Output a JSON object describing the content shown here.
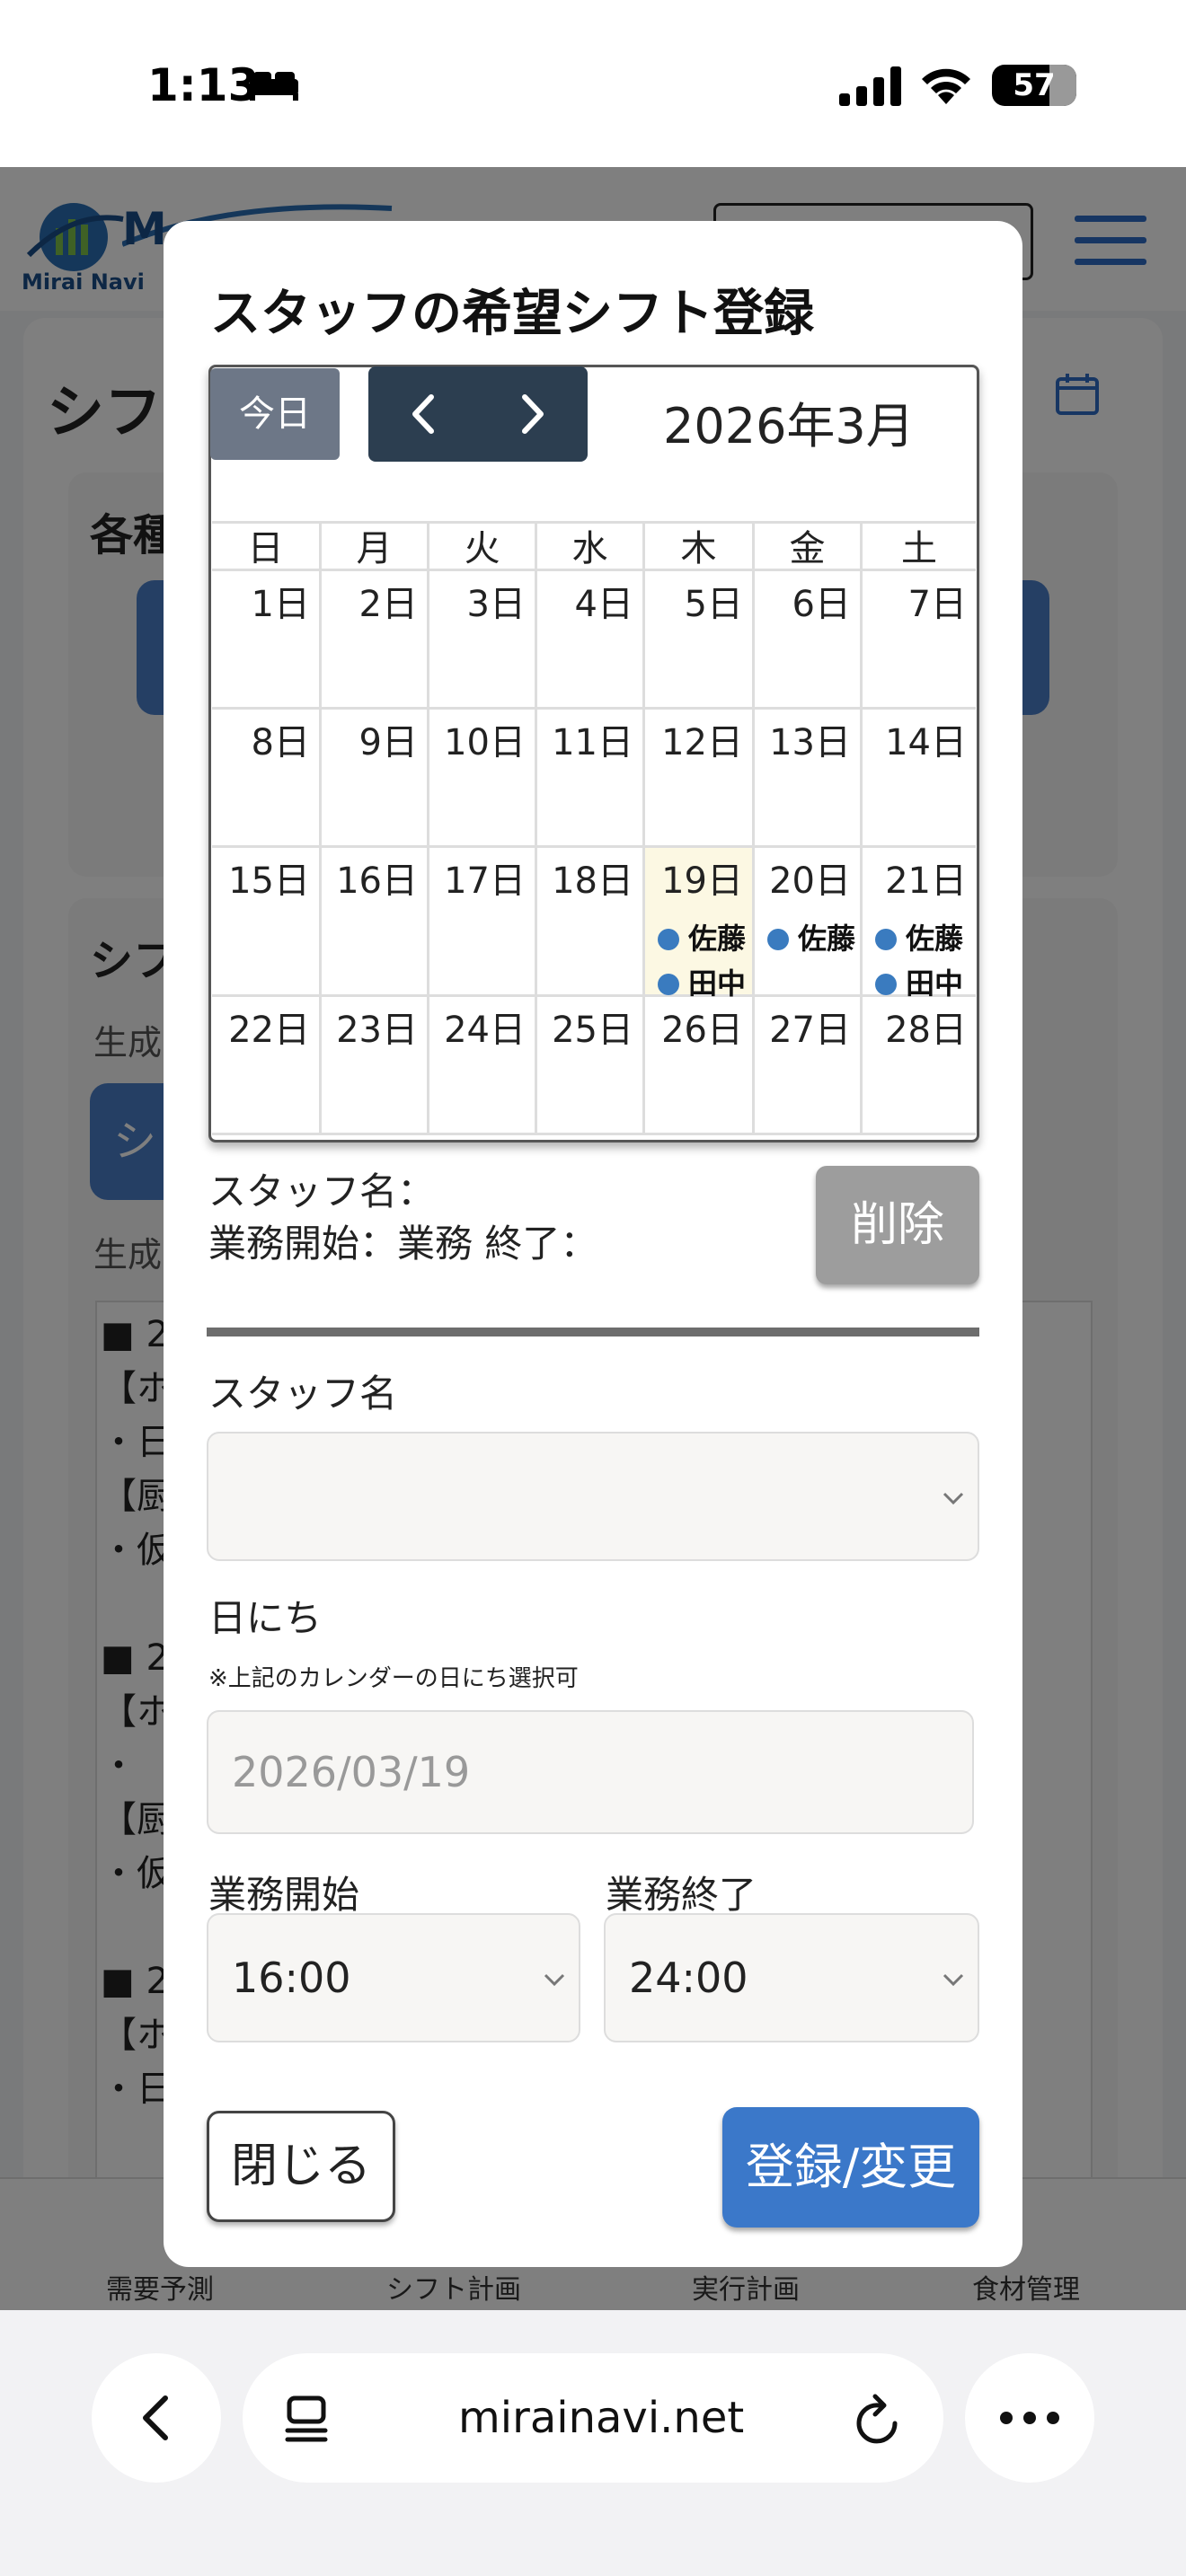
{
  "status_bar": {
    "time": "1:13",
    "battery": "57"
  },
  "background": {
    "logo_text": "Mirai Navi",
    "page_title": "シフ",
    "section1_title": "各種",
    "section2_title": "シフ",
    "generated_label": "生成",
    "generated_label2": "生成",
    "btn_partial": "シ",
    "result_lines": [
      "■ 2",
      "【ホ",
      "・日",
      "【厨",
      "・仮",
      "",
      "■ 2",
      "【ホ",
      "・",
      "【厨",
      "・仮",
      "",
      "■ 2",
      "【ホ",
      "・日"
    ],
    "bottom_nav": [
      "需要予測",
      "シフト計画",
      "実行計画",
      "食材管理"
    ]
  },
  "browser": {
    "url": "mirainavi.net"
  },
  "modal": {
    "title": "スタッフの希望シフト登録",
    "calendar": {
      "today_label": "今日",
      "month_title": "2026年3月",
      "weekdays": [
        "日",
        "月",
        "火",
        "水",
        "木",
        "金",
        "土"
      ],
      "weeks": [
        [
          "1日",
          "2日",
          "3日",
          "4日",
          "5日",
          "6日",
          "7日"
        ],
        [
          "8日",
          "9日",
          "10日",
          "11日",
          "12日",
          "13日",
          "14日"
        ],
        [
          "15日",
          "16日",
          "17日",
          "18日",
          "19日",
          "20日",
          "21日"
        ],
        [
          "22日",
          "23日",
          "24日",
          "25日",
          "26日",
          "27日",
          "28日"
        ]
      ],
      "events": {
        "19日": [
          "佐藤",
          "田中"
        ],
        "20日": [
          "佐藤"
        ],
        "21日": [
          "佐藤",
          "田中"
        ]
      },
      "today_date": "19日"
    },
    "info": {
      "staff_line": "スタッフ名：",
      "time_line": "業務開始：業務 終了："
    },
    "delete_label": "削除",
    "form": {
      "staff_label": "スタッフ名",
      "staff_value": "",
      "date_label": "日にち",
      "date_note": "※上記のカレンダーの日にち選択可",
      "date_placeholder": "2026/03/19",
      "start_label": "業務開始",
      "start_value": "16:00",
      "end_label": "業務終了",
      "end_value": "24:00"
    },
    "close_label": "閉じる",
    "submit_label": "登録/変更"
  },
  "colors": {
    "primary": "#3b78c9",
    "dark_nav": "#2c3e50",
    "today_bg": "#fcf8e3",
    "event_dot": "#3a7bbf"
  }
}
